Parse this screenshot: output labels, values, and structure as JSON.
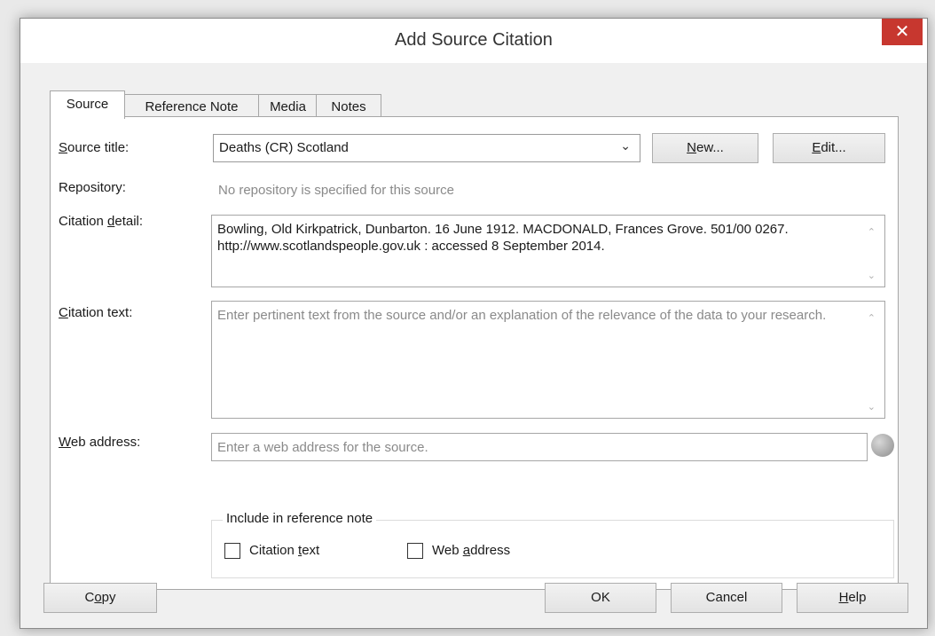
{
  "window": {
    "title": "Add Source Citation",
    "close_label": "✕"
  },
  "tabs": [
    {
      "label": "Source",
      "active": true
    },
    {
      "label": "Reference Note"
    },
    {
      "label": "Media"
    },
    {
      "label": "Notes"
    }
  ],
  "source": {
    "source_title_label_pre": "S",
    "source_title_label_post": "ource title:",
    "source_title_value": "Deaths (CR) Scotland",
    "new_button_pre": "N",
    "new_button_post": "ew...",
    "edit_button_pre": "E",
    "edit_button_post": "dit...",
    "repository_label": "Repository:",
    "repository_value": "No repository is specified for this source",
    "citation_detail_label_pre": "Citation ",
    "citation_detail_label_ul": "d",
    "citation_detail_label_post": "etail:",
    "citation_detail_value": "Bowling, Old Kirkpatrick, Dunbarton. 16 June 1912. MACDONALD, Frances Grove. 501/00 0267. http://www.scotlandspeople.gov.uk : accessed 8 September 2014.",
    "citation_text_label_pre": "C",
    "citation_text_label_post": "itation text:",
    "citation_text_placeholder": "Enter pertinent text from the source and/or an explanation of the relevance of the data to your research.",
    "web_address_label_pre": "W",
    "web_address_label_post": "eb address:",
    "web_address_placeholder": "Enter a web address for the source.",
    "include_group_title": "Include in reference note",
    "cb_citation_pre": "Citation ",
    "cb_citation_ul": "t",
    "cb_citation_post": "ext",
    "cb_web_pre": "Web ",
    "cb_web_ul": "a",
    "cb_web_post": "ddress"
  },
  "footer": {
    "copy_pre": "C",
    "copy_ul": "o",
    "copy_post": "py",
    "ok_label": "OK",
    "cancel_label": "Cancel",
    "help_ul": "H",
    "help_post": "elp"
  },
  "icons": {
    "dropdown": "chevron-down-icon",
    "scroll_up": "scroll-up-icon",
    "scroll_down": "scroll-down-icon",
    "globe": "globe-icon"
  }
}
